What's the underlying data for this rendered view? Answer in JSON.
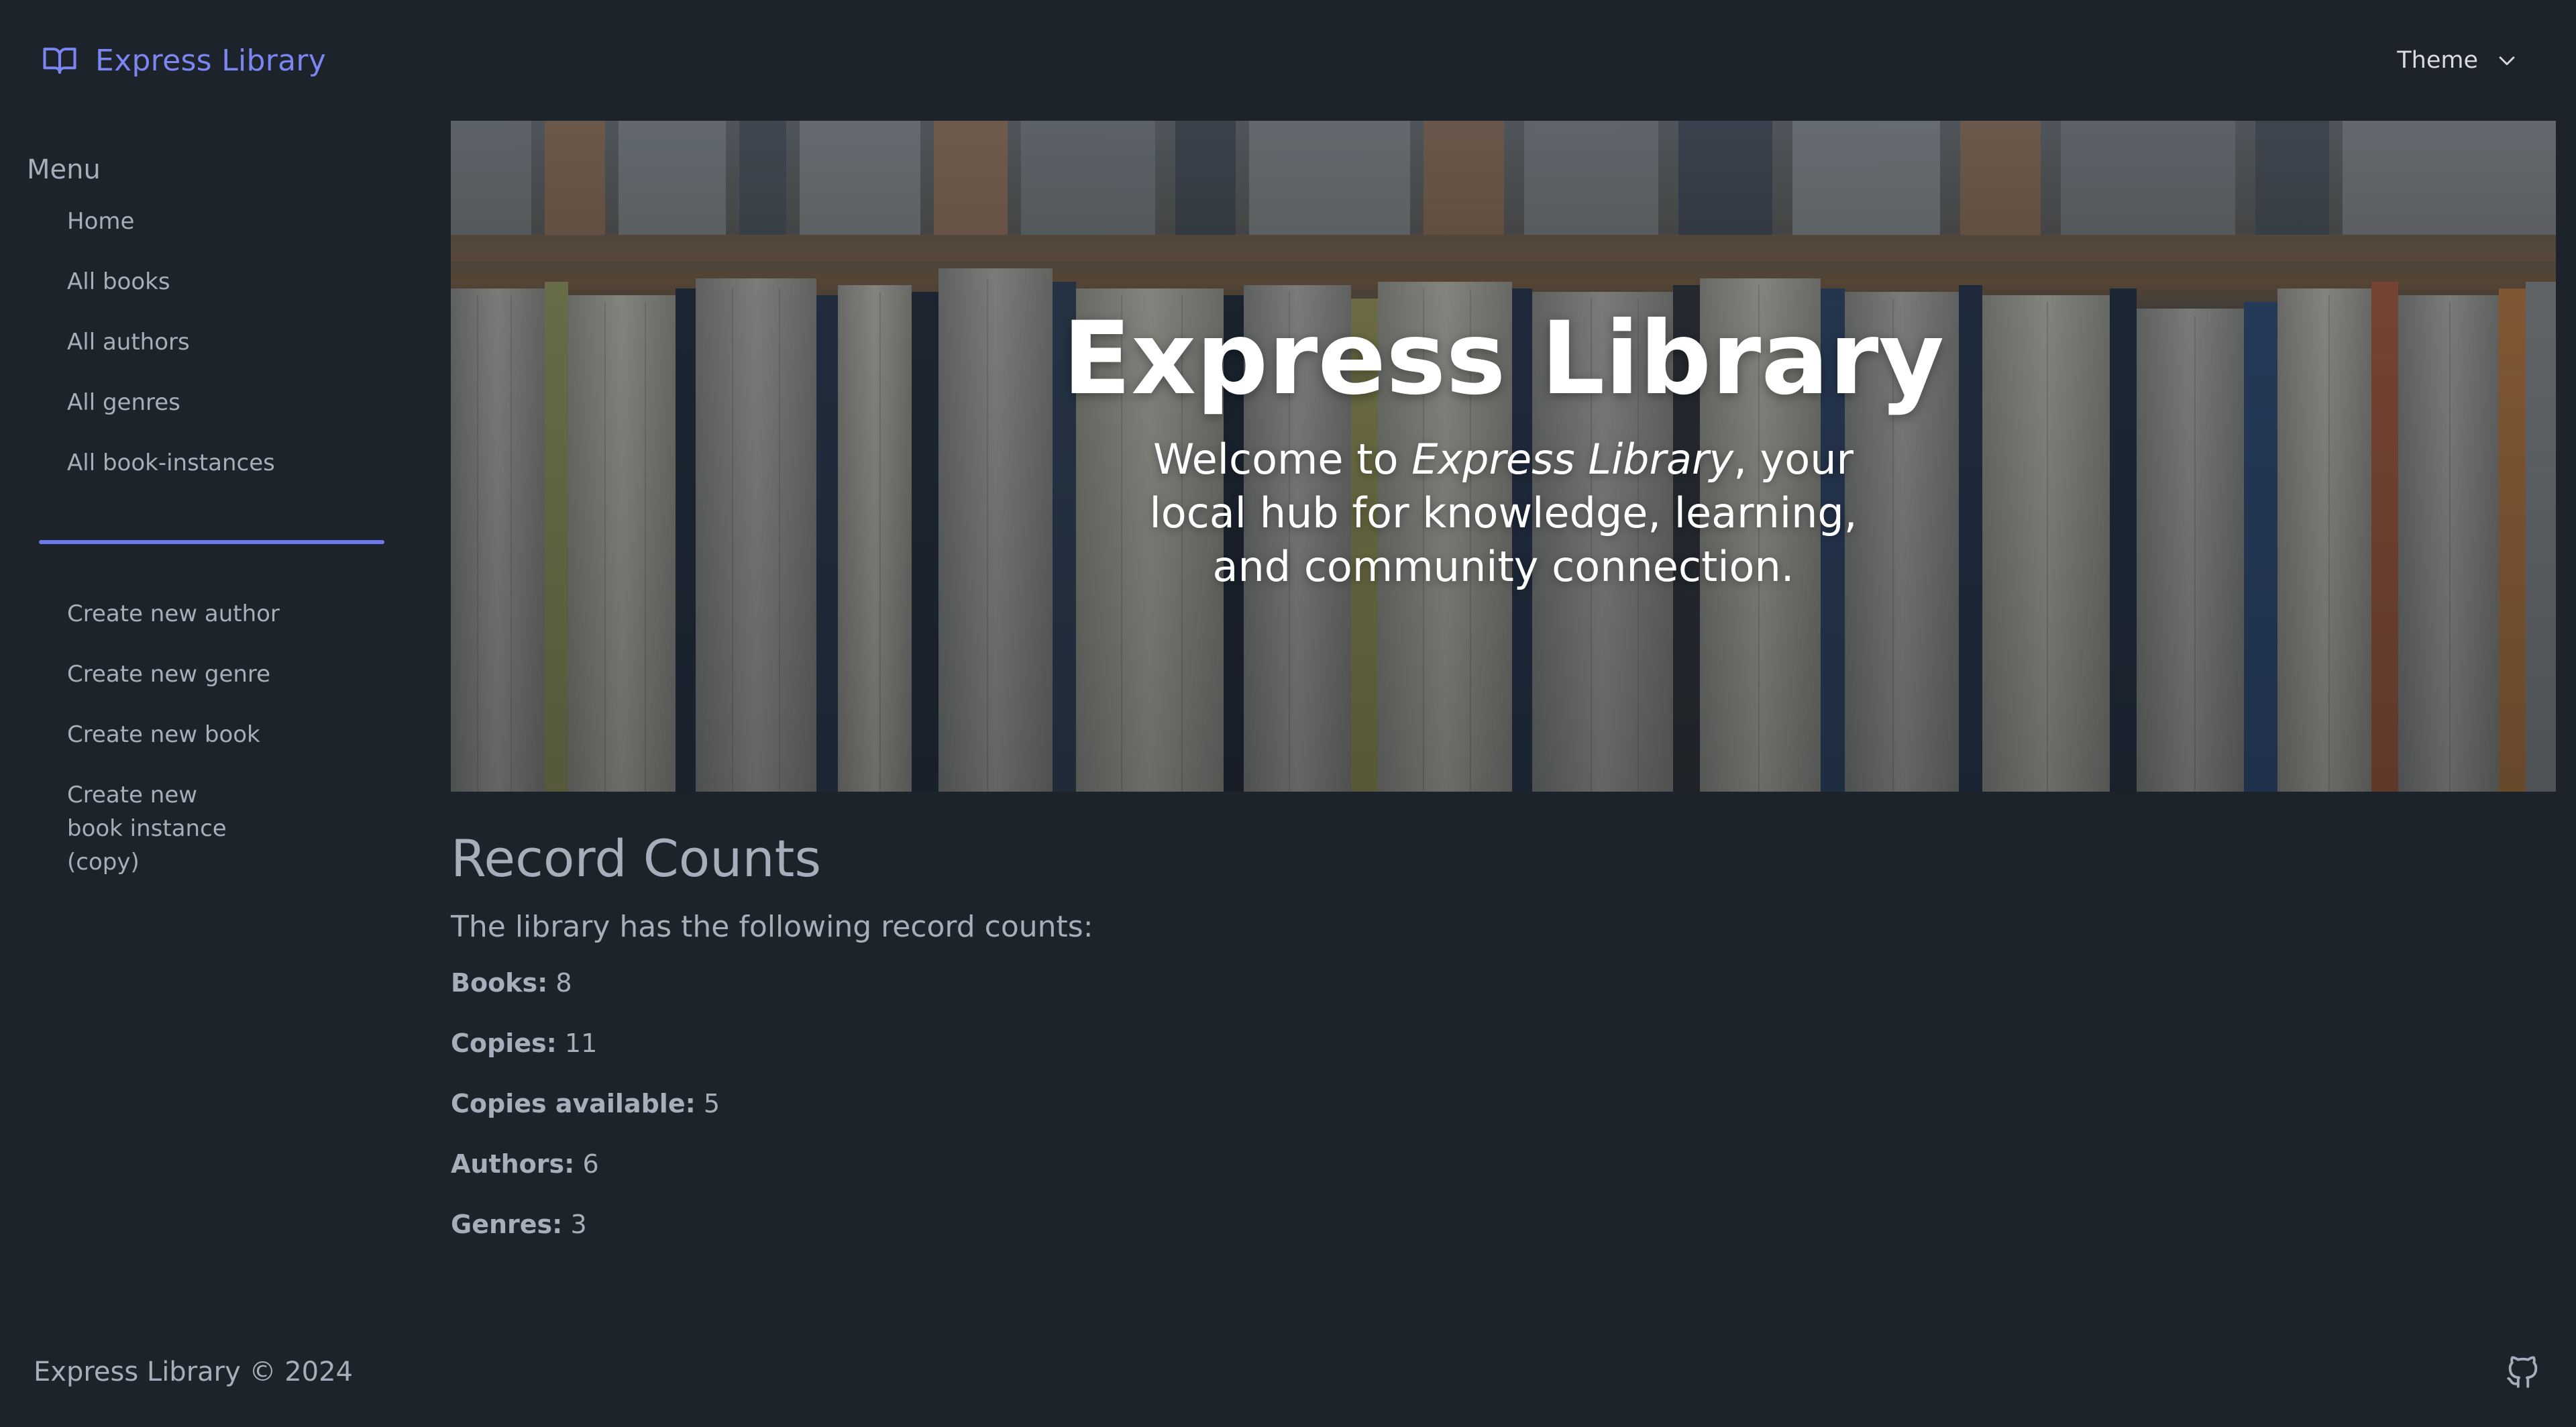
{
  "navbar": {
    "brand": "Express Library",
    "brand_icon": "open-book-icon",
    "theme_label": "Theme",
    "theme_icon": "chevron-down-icon",
    "accent_color": "#7b86f2"
  },
  "sidebar": {
    "title": "Menu",
    "nav_items": [
      {
        "label": "Home"
      },
      {
        "label": "All books"
      },
      {
        "label": "All authors"
      },
      {
        "label": "All genres"
      },
      {
        "label": "All book-instances"
      }
    ],
    "divider_color": "#6d79e6",
    "create_items": [
      {
        "label": "Create new author"
      },
      {
        "label": "Create new genre"
      },
      {
        "label": "Create new book"
      },
      {
        "label": "Create new book instance (copy)"
      }
    ]
  },
  "hero": {
    "title": "Express Library",
    "subtitle_prefix": "Welcome to ",
    "subtitle_emphasis": "Express Library",
    "subtitle_suffix": ", your local hub for knowledge, learning, and community connection.",
    "background": "bookshelf-photo"
  },
  "records": {
    "title": "Record Counts",
    "lead": "The library has the following record counts:",
    "items": [
      {
        "label": "Books:",
        "value": "8"
      },
      {
        "label": "Copies:",
        "value": "11"
      },
      {
        "label": "Copies available:",
        "value": "5"
      },
      {
        "label": "Authors:",
        "value": "6"
      },
      {
        "label": "Genres:",
        "value": "3"
      }
    ]
  },
  "footer": {
    "text": "Express Library © 2024",
    "icon": "github-icon"
  }
}
